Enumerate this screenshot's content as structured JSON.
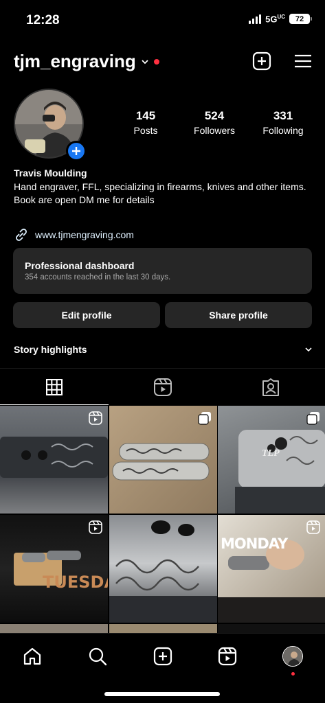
{
  "status_bar": {
    "time": "12:28",
    "network": "5G",
    "network_suffix": "UC",
    "battery": "72"
  },
  "header": {
    "username": "tjm_engraving",
    "new_post_icon": "plus-square-icon",
    "menu_icon": "hamburger-menu-icon"
  },
  "profile": {
    "stats": [
      {
        "value": "145",
        "label": "Posts"
      },
      {
        "value": "524",
        "label": "Followers"
      },
      {
        "value": "331",
        "label": "Following"
      }
    ],
    "name": "Travis Moulding",
    "bio_line1": "Hand engraver, FFL, specializing in firearms, knives and other items.",
    "bio_line2": "Book are open DM me for details",
    "link": "www.tjmengraving.com"
  },
  "dashboard": {
    "title": "Professional dashboard",
    "subtitle": "354 accounts reached in the last 30 days."
  },
  "buttons": {
    "edit": "Edit profile",
    "share": "Share profile"
  },
  "highlights": {
    "title": "Story highlights"
  },
  "tabs": [
    {
      "name": "grid",
      "icon": "grid-icon",
      "active": true
    },
    {
      "name": "reels",
      "icon": "reels-icon",
      "active": false
    },
    {
      "name": "tagged",
      "icon": "tagged-person-icon",
      "active": false
    }
  ],
  "grid_posts": [
    {
      "kind": "reel",
      "overlay_text": ""
    },
    {
      "kind": "carousel",
      "overlay_text": ""
    },
    {
      "kind": "carousel",
      "overlay_text": "TLP"
    },
    {
      "kind": "reel",
      "overlay_text": "TUESDAY"
    },
    {
      "kind": "photo",
      "overlay_text": ""
    },
    {
      "kind": "reel",
      "overlay_text": "MONDAY"
    }
  ],
  "colors": {
    "accent_blue": "#1877f2",
    "notification_red": "#ff3040",
    "card_bg": "#262626"
  }
}
